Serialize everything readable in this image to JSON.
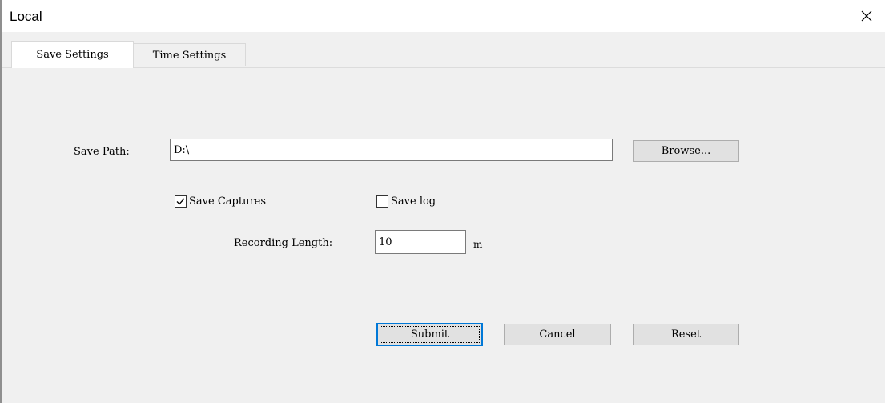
{
  "window": {
    "title": "Local",
    "close_icon": "close-icon"
  },
  "tabs": [
    {
      "label": "Save Settings",
      "active": true
    },
    {
      "label": "Time Settings",
      "active": false
    }
  ],
  "save_settings": {
    "save_path_label": "Save Path:",
    "save_path_value": "D:\\",
    "browse_label": "Browse...",
    "save_captures": {
      "label": "Save Captures",
      "checked": true
    },
    "save_log": {
      "label": "Save log",
      "checked": false
    },
    "recording_length_label": "Recording Length:",
    "recording_length_value": "10",
    "recording_length_unit": "m"
  },
  "buttons": {
    "submit": "Submit",
    "cancel": "Cancel",
    "reset": "Reset"
  },
  "colors": {
    "window_bg": "#f0f0f0",
    "titlebar_bg": "#ffffff",
    "default_button_border": "#0078d7",
    "button_bg": "#e1e1e1"
  }
}
